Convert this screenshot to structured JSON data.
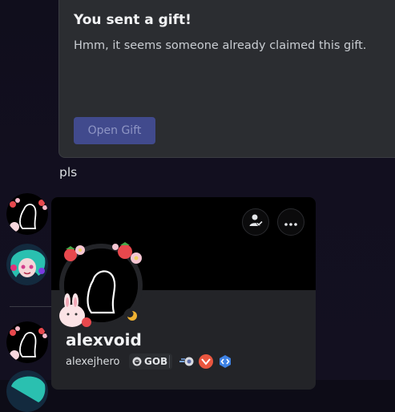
{
  "gift": {
    "title": "You sent a gift!",
    "message": "Hmm, it seems someone already claimed this gift.",
    "button_label": "Open Gift"
  },
  "messages": [
    {
      "text": "pls"
    }
  ],
  "profile": {
    "display_name": "alexvoid",
    "username": "alexejhero",
    "guild_tag": "GOB",
    "status": "idle",
    "badges": [
      "nitro-orb-badge",
      "boost-badge",
      "hypesquad-badge",
      "developer-badge"
    ]
  },
  "colors": {
    "accent": "#414a8d",
    "card_bg": "#232428",
    "gift_bg": "#2b2d31",
    "idle": "#f0b232"
  },
  "icons": {
    "friend_action": "person-check-icon",
    "more": "more-dots-icon"
  }
}
